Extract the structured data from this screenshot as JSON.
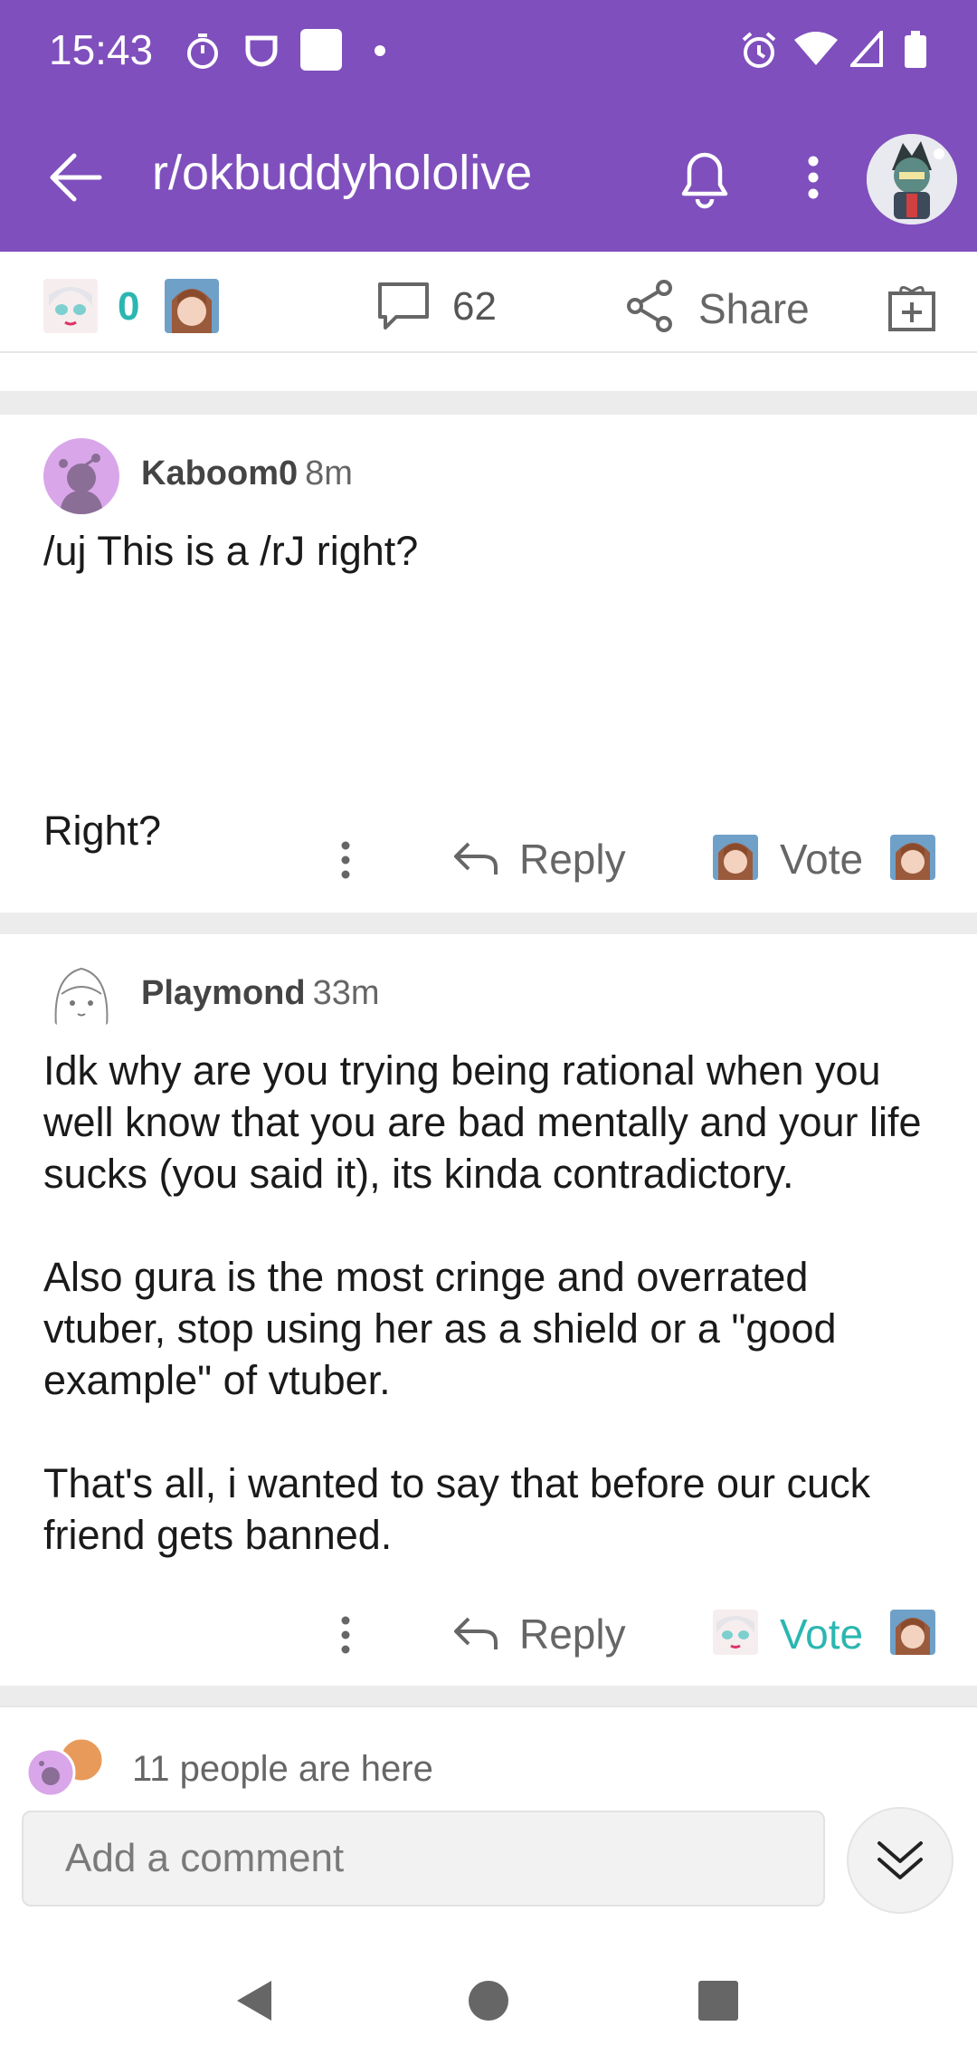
{
  "status_bar": {
    "time": "15:43"
  },
  "header": {
    "title": "r/okbuddyhololive",
    "back_icon": "arrow-left-icon",
    "bell_icon": "bell-icon",
    "menu_icon": "more-vertical-icon"
  },
  "post_bar": {
    "vote_count": "0",
    "comment_count": "62",
    "share_label": "Share"
  },
  "comments": [
    {
      "username": "Kaboom0",
      "time": "8m",
      "paragraphs": [
        "/uj This is a /rJ right?",
        "",
        "Right?"
      ],
      "reply_label": "Reply",
      "vote_label": "Vote",
      "vote_active": false
    },
    {
      "username": "Playmond",
      "time": "33m",
      "paragraphs": [
        "Idk why are you trying being rational when you well know that you are bad mentally and your life sucks (you said it), its kinda contradictory.",
        "Also gura is the most cringe and overrated vtuber, stop using her as a shield or a \"good example\" of vtuber.",
        "That's all, i wanted to say that before our cuck friend gets banned."
      ],
      "reply_label": "Reply",
      "vote_label": "Vote",
      "vote_active": true
    }
  ],
  "composer": {
    "presence_text": "11 people are here",
    "placeholder": "Add a comment"
  },
  "colors": {
    "brand": "#7f4fbd",
    "accent": "#2bb6b1"
  }
}
